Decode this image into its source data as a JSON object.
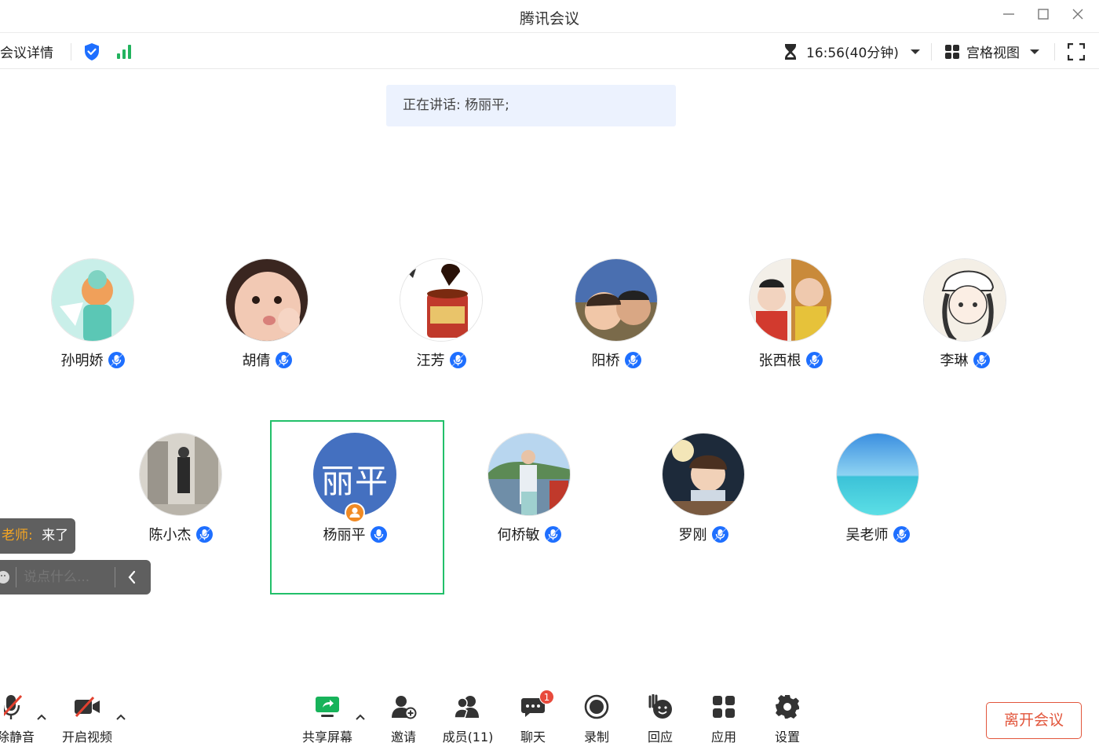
{
  "window": {
    "title": "腾讯会议"
  },
  "toolbar": {
    "meeting_details": "会议详情",
    "timer": "16:56(40分钟)",
    "view_mode": "宫格视图"
  },
  "speaking_banner": "正在讲话: 杨丽平;",
  "participants": [
    {
      "name": "孙明娇"
    },
    {
      "name": "胡倩"
    },
    {
      "name": "汪芳"
    },
    {
      "name": "阳桥"
    },
    {
      "name": "张西根"
    },
    {
      "name": "李琳"
    },
    {
      "name": "陈小杰"
    },
    {
      "name": "杨丽平",
      "avatar_text": "丽平",
      "avatar_color": "#4470c0",
      "is_host": true,
      "speaking": true
    },
    {
      "name": "何桥敏"
    },
    {
      "name": "罗刚"
    },
    {
      "name": "吴老师"
    }
  ],
  "chat": {
    "sender": "老师:",
    "message": "来了",
    "sender_color": "#f5a623",
    "placeholder": "说点什么..."
  },
  "bottom_bar": {
    "mute_label": "除静音",
    "video_label": "开启视频",
    "share_label": "共享屏幕",
    "invite_label": "邀请",
    "members_label": "成员(11)",
    "chat_label": "聊天",
    "chat_badge": "1",
    "record_label": "录制",
    "react_label": "回应",
    "apps_label": "应用",
    "settings_label": "设置",
    "leave_label": "离开会议"
  },
  "colors": {
    "accent_blue": "#1e6fff",
    "active_border": "#22c06a",
    "leave_red": "#e2563c",
    "signal_green": "#22b35e"
  }
}
